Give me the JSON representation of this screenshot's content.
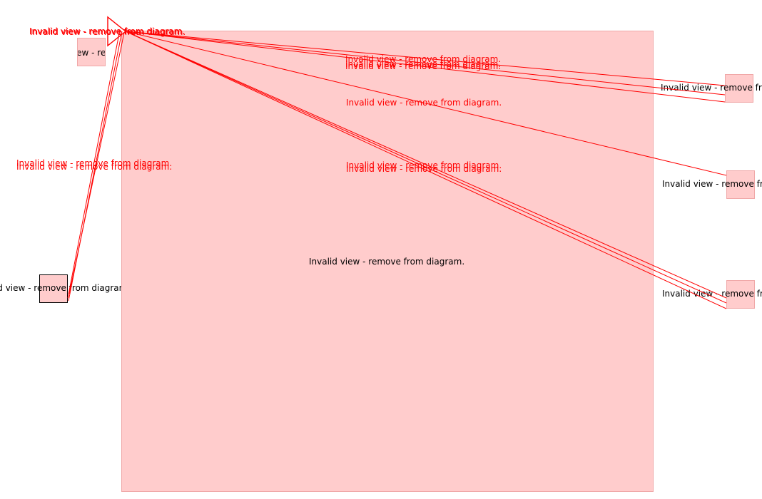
{
  "diagram": {
    "invalid_text": "Invalid view - remove from diagram.",
    "colors": {
      "node_fill": "#ffcccc",
      "node_border": "#f0a8a8",
      "edge": "#ff0000",
      "edge_label": "#ff0000",
      "selected_border": "#000000"
    },
    "nodes": {
      "big": {
        "label": "Invalid view - remove from diagram."
      },
      "small_top_left": {
        "label": "Invalid view - remove from diagram."
      },
      "small_left_selected": {
        "label": "Invalid view - remove from diagram."
      },
      "right_1": {
        "label": "Invalid view - remove from diagram."
      },
      "right_2": {
        "label": "Invalid view - remove from diagram."
      },
      "right_3": {
        "label": "Invalid view - remove from diagram."
      }
    },
    "edge_labels": [
      "Invalid view - remove from diagram.",
      "Invalid view - remove from diagram.",
      "Invalid view - remove from diagram.",
      "Invalid view - remove from diagram.",
      "Invalid view - remove from diagram.",
      "Invalid view - remove from diagram.",
      "Invalid view - remove from diagram.",
      "Invalid view - remove from diagram.",
      "Invalid view - remove from diagram.",
      "Invalid view - remove from diagram."
    ]
  }
}
